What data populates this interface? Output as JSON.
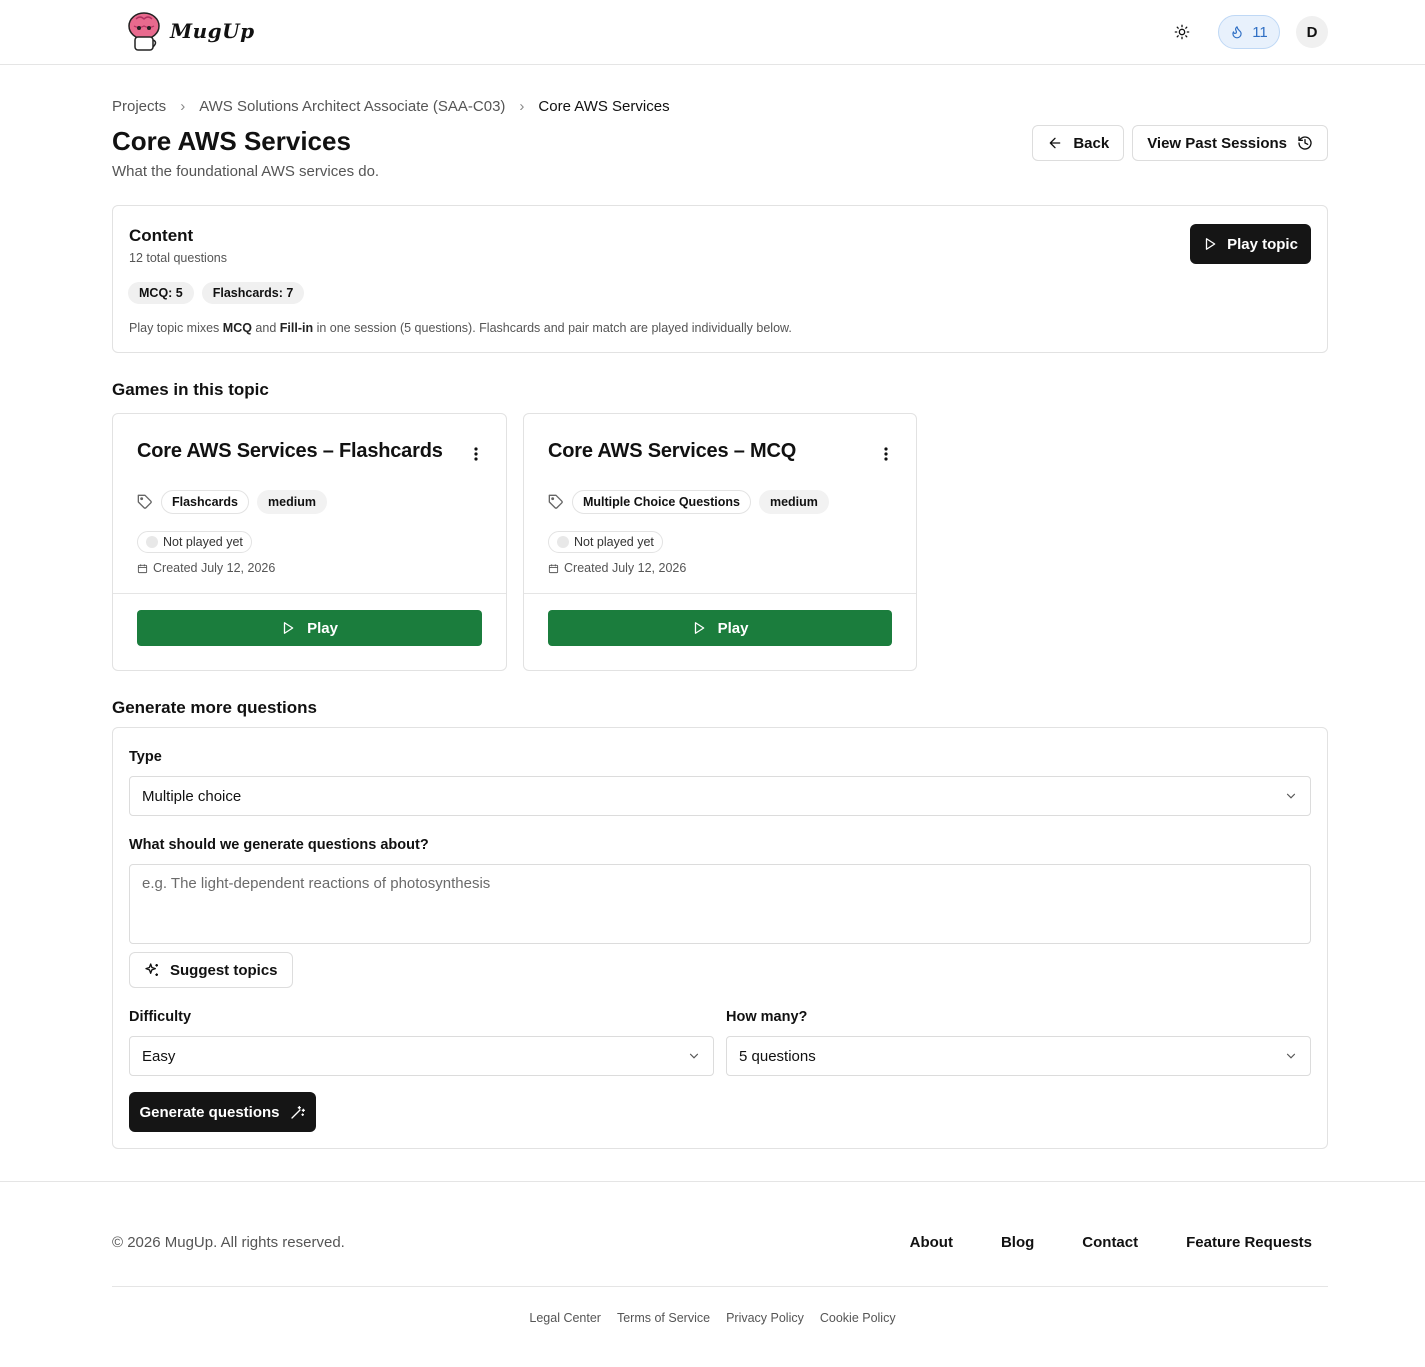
{
  "app": {
    "name": "MugUp"
  },
  "header": {
    "streak_count": "11",
    "avatar_initial": "D"
  },
  "breadcrumb": {
    "items": [
      "Projects",
      "AWS Solutions Architect Associate (SAA-C03)",
      "Core AWS Services"
    ]
  },
  "page": {
    "title": "Core AWS Services",
    "subtitle": "What the foundational AWS services do.",
    "back_label": "Back",
    "past_sessions_label": "View Past Sessions"
  },
  "content": {
    "title": "Content",
    "total": "12 total questions",
    "mcq_chip": "MCQ: 5",
    "flashcards_chip": "Flashcards: 7",
    "note_prefix": "Play topic mixes ",
    "note_mcq": "MCQ",
    "note_and": " and ",
    "note_fill": "Fill-in",
    "note_suffix": " in one session (5 questions). Flashcards and pair match are played individually below.",
    "play_topic_label": "Play topic"
  },
  "games_section": {
    "title": "Games in this topic",
    "games": [
      {
        "title": "Core AWS Services – Flashcards",
        "type_tag": "Flashcards",
        "difficulty_tag": "medium",
        "status": "Not played yet",
        "created": "Created July 12, 2026",
        "play_label": "Play"
      },
      {
        "title": "Core AWS Services – MCQ",
        "type_tag": "Multiple Choice Questions",
        "difficulty_tag": "medium",
        "status": "Not played yet",
        "created": "Created July 12, 2026",
        "play_label": "Play"
      }
    ]
  },
  "generate": {
    "section_title": "Generate more questions",
    "type_label": "Type",
    "type_value": "Multiple choice",
    "topic_label": "What should we generate questions about?",
    "topic_placeholder": "e.g. The light-dependent reactions of photosynthesis",
    "suggest_label": "Suggest topics",
    "difficulty_label": "Difficulty",
    "difficulty_value": "Easy",
    "count_label": "How many?",
    "count_value": "5 questions",
    "generate_label": "Generate questions"
  },
  "footer": {
    "copyright": "© 2026 MugUp. All rights reserved.",
    "links": [
      "About",
      "Blog",
      "Contact",
      "Feature Requests"
    ],
    "legal_links": [
      "Legal Center",
      "Terms of Service",
      "Privacy Policy",
      "Cookie Policy"
    ]
  },
  "colors": {
    "accent_green": "#1b7d3d",
    "dark_button": "#151515",
    "streak_blue": "#2f6fc4"
  }
}
